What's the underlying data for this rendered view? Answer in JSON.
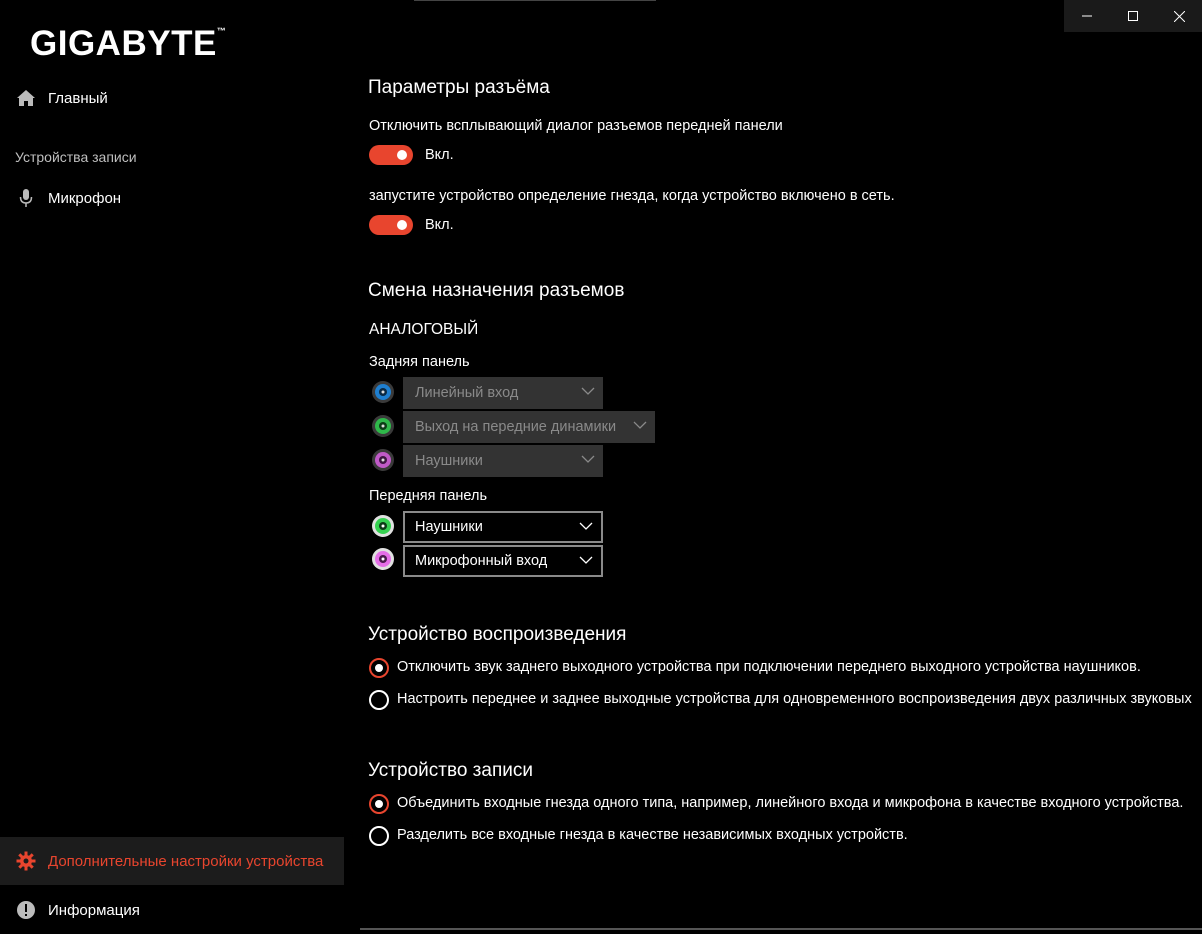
{
  "window": {
    "minimize_icon": "minimize-icon",
    "maximize_icon": "maximize-icon",
    "close_icon": "close-icon"
  },
  "sidebar": {
    "logo": "GIGABYTE",
    "logo_mark": "™",
    "home": {
      "label": "Главный",
      "icon": "home-icon"
    },
    "recording_section": "Устройства записи",
    "microphone": {
      "label": "Микрофон",
      "icon": "microphone-icon"
    },
    "advanced": {
      "label": "Дополнительные настройки устройства",
      "icon": "gear-icon"
    },
    "info": {
      "label": "Информация",
      "icon": "info-icon"
    }
  },
  "accent_color": "#e8452e",
  "jack_params": {
    "title": "Параметры разъёма",
    "option1": {
      "label": "Отключить всплывающий диалог разъемов передней панели",
      "state": "Вкл."
    },
    "option2": {
      "label": "запустите устройство определение гнезда, когда  устройство включено в сеть.",
      "state": "Вкл."
    }
  },
  "retasking": {
    "title": "Смена назначения разъемов",
    "analog": "АНАЛОГОВЫЙ",
    "rear_panel": {
      "label": "Задняя панель",
      "jacks": [
        {
          "color": "#1f7fd0",
          "value": "Линейный вход"
        },
        {
          "color": "#2fb84a",
          "value": "Выход на передние динамики"
        },
        {
          "color": "#c05ac8",
          "value": "Наушники"
        }
      ]
    },
    "front_panel": {
      "label": "Передняя панель",
      "jacks": [
        {
          "color": "#35d150",
          "value": "Наушники"
        },
        {
          "color": "#e56ee8",
          "value": "Микрофонный вход"
        }
      ]
    }
  },
  "playback": {
    "title": "Устройство воспроизведения",
    "option1": "Отключить звук заднего выходного устройства при подключении переднего выходного устройства наушников.",
    "option2": "Настроить переднее и заднее выходные устройства для одновременного воспроизведения двух различных звуковых",
    "selected": 1
  },
  "recording": {
    "title": "Устройство записи",
    "option1": "Объединить входные гнезда одного типа, например, линейного входа и микрофона в качестве входного устройства.",
    "option2": "Разделить все входные гнезда в качестве независимых входных устройств.",
    "selected": 1
  }
}
